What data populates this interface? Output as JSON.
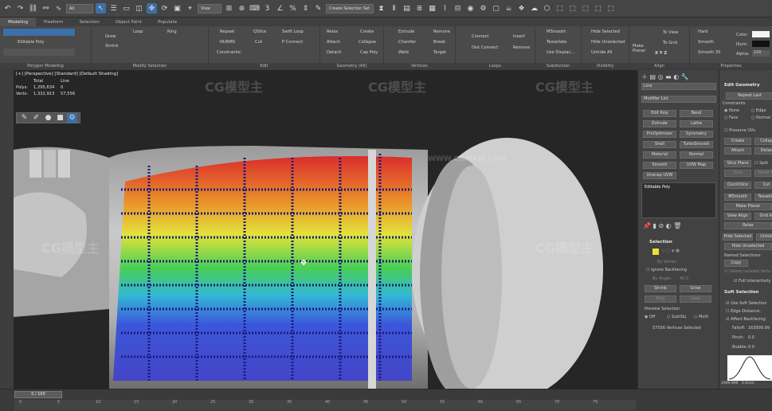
{
  "toolbar": {
    "select_filter": "All",
    "view_dropdown": "View",
    "selection_set": "Create Selection Set"
  },
  "ribbon_tabs": [
    "Modeling",
    "Freeform",
    "Selection",
    "Object Paint",
    "Populate"
  ],
  "ribbon": {
    "editable_poly": "Editable Poly",
    "polygon_modeling": "Polygon Modeling",
    "grow": "Grow",
    "shrink": "Shrink",
    "loop": "Loop",
    "ring": "Ring",
    "modify_selection": "Modify Selection",
    "repeat": "Repeat",
    "nurms": "NURMS",
    "constraints": "Constraints:",
    "qslice": "QSlice",
    "cut": "Cut",
    "swift_loop": "Swift Loop",
    "p_connect": "P Connect",
    "edit": "Edit",
    "relax": "Relax",
    "create": "Create",
    "attach": "Attach",
    "collapse": "Collapse",
    "detach": "Detach",
    "cap_poly": "Cap Poly",
    "geometry_all": "Geometry (All)",
    "extrude": "Extrude",
    "remove": "Remove",
    "chamfer": "Chamfer",
    "break": "Break",
    "weld": "Weld",
    "target": "Target",
    "vertices": "Vertices",
    "connect": "Connect",
    "insert": "Insert",
    "dist_connect": "Dist Connect",
    "remove2": "Remove",
    "loops": "Loops",
    "msmooth": "MSmooth",
    "tessellate": "Tessellate",
    "use_displac": "Use Displac...",
    "subdivision": "Subdivision",
    "hide_selected": "Hide Selected",
    "hide_unselected": "Hide Unselected",
    "unhide_all": "Unhide All",
    "visibility": "Visibility",
    "make_planar": "Make Planar",
    "to_view": "To View",
    "to_grid": "To Grid",
    "align": "Align",
    "hard": "Hard",
    "smooth": "Smooth",
    "smooth30": "Smooth 30",
    "properties": "Properties",
    "color": "Color:",
    "illum": "Illum:",
    "alpha": "Alpha:",
    "alpha_value": "100"
  },
  "viewport": {
    "label": "[+] [Perspective] [Standard] [Default Shading]",
    "stats_total_header": "Total",
    "stats_line_header": "Line",
    "polys_label": "Polys:",
    "polys_total": "1,295,634",
    "polys_line": "0",
    "verts_label": "Verts:",
    "verts_total": "1,332,913",
    "verts_line": "57,556",
    "watermark": "CG模型主",
    "watermark_url": "WWW.CGMXW.COM"
  },
  "command_panel": {
    "object_name": "Line",
    "modifier_list": "Modifier List",
    "buttons": [
      "Edit Poly",
      "Bend",
      "Extrude",
      "Lathe",
      "ProOptimizer",
      "Symmetry",
      "Shell",
      "TurboSmooth",
      "Material",
      "Normal",
      "Smooth",
      "UVW Map",
      "Unwrap UVW"
    ],
    "stack_item": "Editable Poly",
    "selection_title": "Selection",
    "by_vertex": "By Vertex",
    "ignore_backfacing": "Ignore Backfacing",
    "by_angle": "By Angle:",
    "by_angle_value": "45.0",
    "shrink": "Shrink",
    "grow": "Grow",
    "ring": "Ring",
    "loop": "Loop",
    "preview_selection": "Preview Selection",
    "off": "Off",
    "subobj": "SubObj",
    "multi": "Multi",
    "selected_count": "57556 Vertices Selected"
  },
  "edit_geometry": {
    "title": "Edit Geometry",
    "repeat_last": "Repeat Last",
    "constraints": "Constraints",
    "none": "None",
    "edge": "Edge",
    "face": "Face",
    "normal": "Normal",
    "preserve_uvs": "Preserve UVs",
    "create": "Create",
    "collapse": "Collap",
    "attach": "Attach",
    "detach": "Detac",
    "slice_plane": "Slice Plane",
    "split": "Split",
    "slice": "Slice",
    "reset_plane": "Reset Pl",
    "quickslice": "QuickSlice",
    "cut": "Cut",
    "msmooth": "MSmooth",
    "tessellate": "Tessellat",
    "make_planar": "Make Planar",
    "view_align": "View Align",
    "grid_align": "Grid Al",
    "relax": "Relax",
    "hide_selected": "Hide Selected",
    "unhide": "Unhide",
    "hide_unselected": "Hide Unselected",
    "named_selections": "Named Selections:",
    "copy": "Copy",
    "delete_isolated": "Delete Isolated Verts",
    "full_interactivity": "Full Interactivity",
    "soft_selection": "Soft Selection",
    "use_soft_selection": "Use Soft Selection",
    "edge_distance": "Edge Distance:",
    "affect_backfacing": "Affect Backfacing",
    "falloff": "Falloff:",
    "falloff_value": "163999.99",
    "pinch": "Pinch:",
    "pinch_value": "0.0",
    "bubble": "Bubble:",
    "bubble_value": "0.0",
    "curve_min": "1999.999",
    "curve_mid": "0.0mm",
    "curve_max": "1999.999",
    "shaded_face": "Shaded Face Toggle"
  },
  "timeline": {
    "frame": "0 / 100",
    "ticks": [
      "0",
      "5",
      "10",
      "15",
      "20",
      "25",
      "30",
      "35",
      "40",
      "45",
      "50",
      "55",
      "60",
      "65",
      "70",
      "75"
    ]
  },
  "colors": {
    "accent_blue": "#3d6fa8",
    "selected_yellow": "#e8e230",
    "viewport_bg": "#262626"
  }
}
